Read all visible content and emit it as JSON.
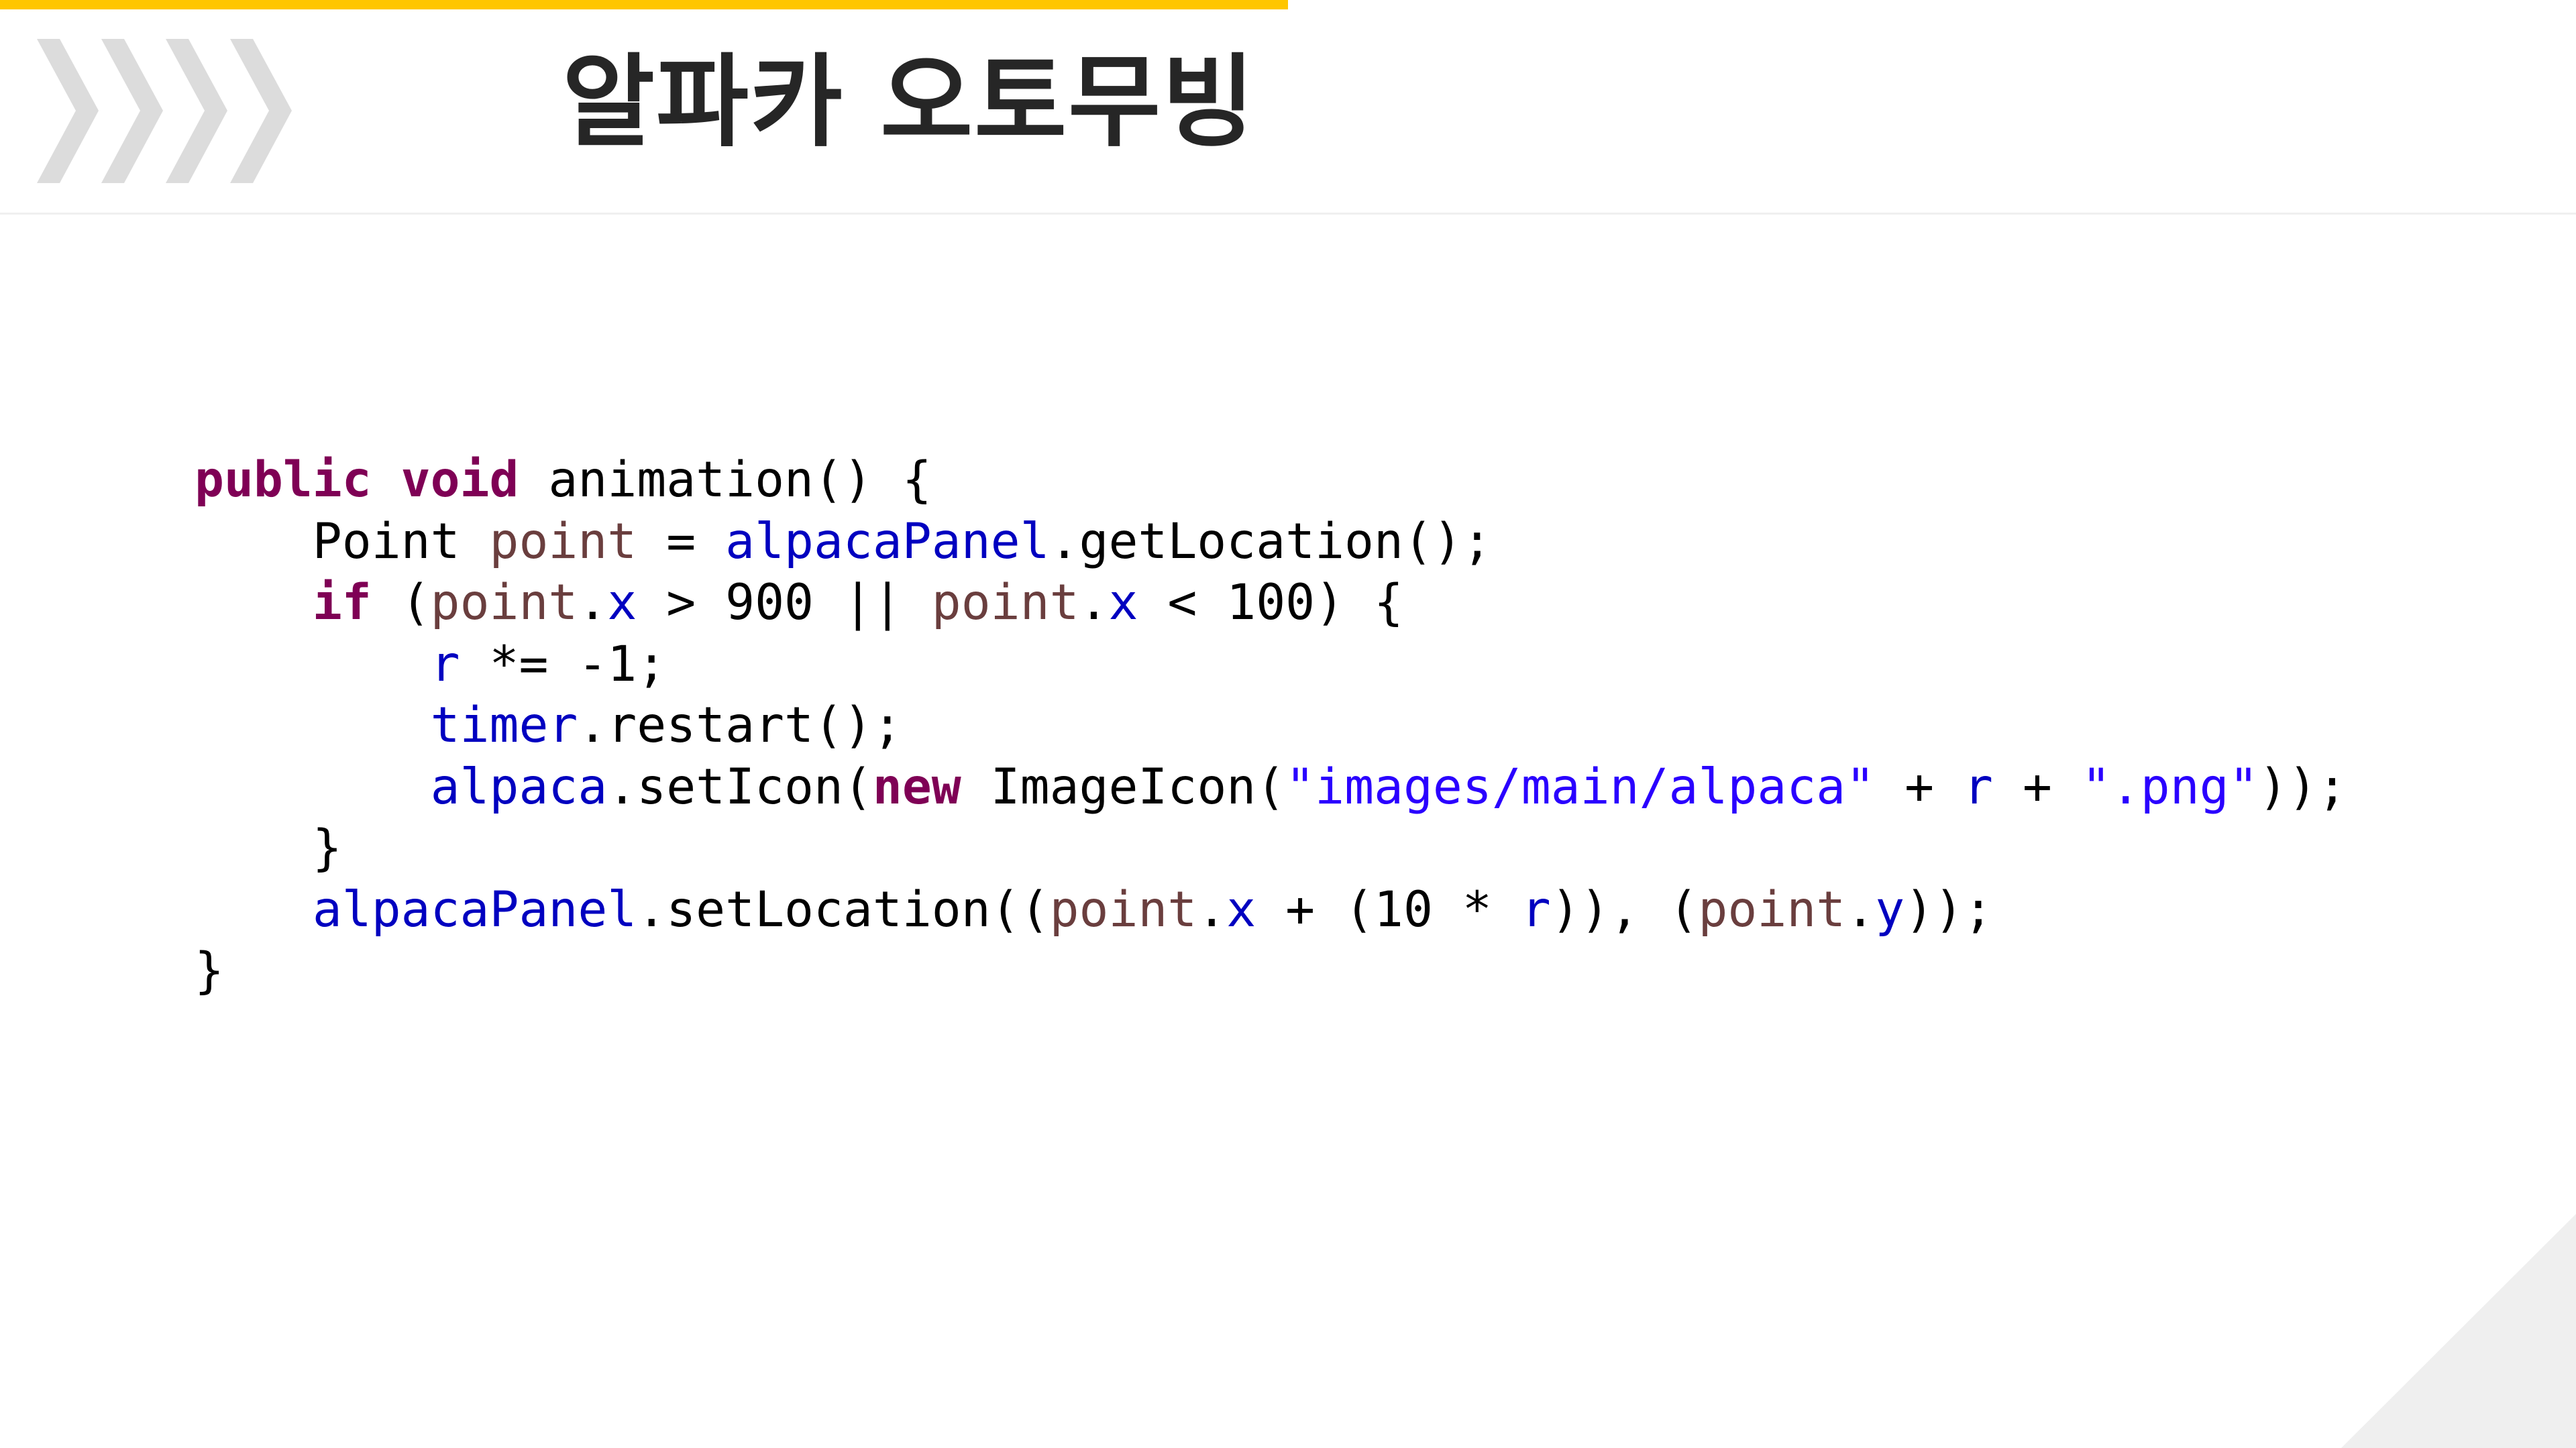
{
  "slide": {
    "title": "알파카 오토무빙",
    "accent_color": "#ffc600",
    "decoration": {
      "header_icon": "chevrons-right-icon",
      "corner_shape": "corner-triangle"
    }
  },
  "code": {
    "language": "java",
    "colors": {
      "keyword": "#7f0055",
      "field": "#0000c0",
      "local": "#6a3e3e",
      "string": "#2a00ff",
      "default": "#000000"
    },
    "lines": [
      [
        {
          "t": "public",
          "c": "kw"
        },
        {
          "t": " "
        },
        {
          "t": "void",
          "c": "kw"
        },
        {
          "t": " animation() {"
        }
      ],
      [
        {
          "t": "    Point "
        },
        {
          "t": "point",
          "c": "loc"
        },
        {
          "t": " = "
        },
        {
          "t": "alpacaPanel",
          "c": "fld"
        },
        {
          "t": ".getLocation();"
        }
      ],
      [
        {
          "t": "    "
        },
        {
          "t": "if",
          "c": "kw"
        },
        {
          "t": " ("
        },
        {
          "t": "point",
          "c": "loc"
        },
        {
          "t": "."
        },
        {
          "t": "x",
          "c": "fld"
        },
        {
          "t": " > 900 || "
        },
        {
          "t": "point",
          "c": "loc"
        },
        {
          "t": "."
        },
        {
          "t": "x",
          "c": "fld"
        },
        {
          "t": " < 100) {"
        }
      ],
      [
        {
          "t": "        "
        },
        {
          "t": "r",
          "c": "fld"
        },
        {
          "t": " *= -1;"
        }
      ],
      [
        {
          "t": "        "
        },
        {
          "t": "timer",
          "c": "fld"
        },
        {
          "t": ".restart();"
        }
      ],
      [
        {
          "t": "        "
        },
        {
          "t": "alpaca",
          "c": "fld"
        },
        {
          "t": ".setIcon("
        },
        {
          "t": "new",
          "c": "kw"
        },
        {
          "t": " ImageIcon("
        },
        {
          "t": "\"images/main/alpaca\"",
          "c": "str"
        },
        {
          "t": " + "
        },
        {
          "t": "r",
          "c": "fld"
        },
        {
          "t": " + "
        },
        {
          "t": "\".png\"",
          "c": "str"
        },
        {
          "t": "));"
        }
      ],
      [
        {
          "t": "    }"
        }
      ],
      [
        {
          "t": "    "
        },
        {
          "t": "alpacaPanel",
          "c": "fld"
        },
        {
          "t": ".setLocation(("
        },
        {
          "t": "point",
          "c": "loc"
        },
        {
          "t": "."
        },
        {
          "t": "x",
          "c": "fld"
        },
        {
          "t": " + (10 * "
        },
        {
          "t": "r",
          "c": "fld"
        },
        {
          "t": ")), ("
        },
        {
          "t": "point",
          "c": "loc"
        },
        {
          "t": "."
        },
        {
          "t": "y",
          "c": "fld"
        },
        {
          "t": "));"
        }
      ],
      [
        {
          "t": "}"
        }
      ]
    ]
  }
}
